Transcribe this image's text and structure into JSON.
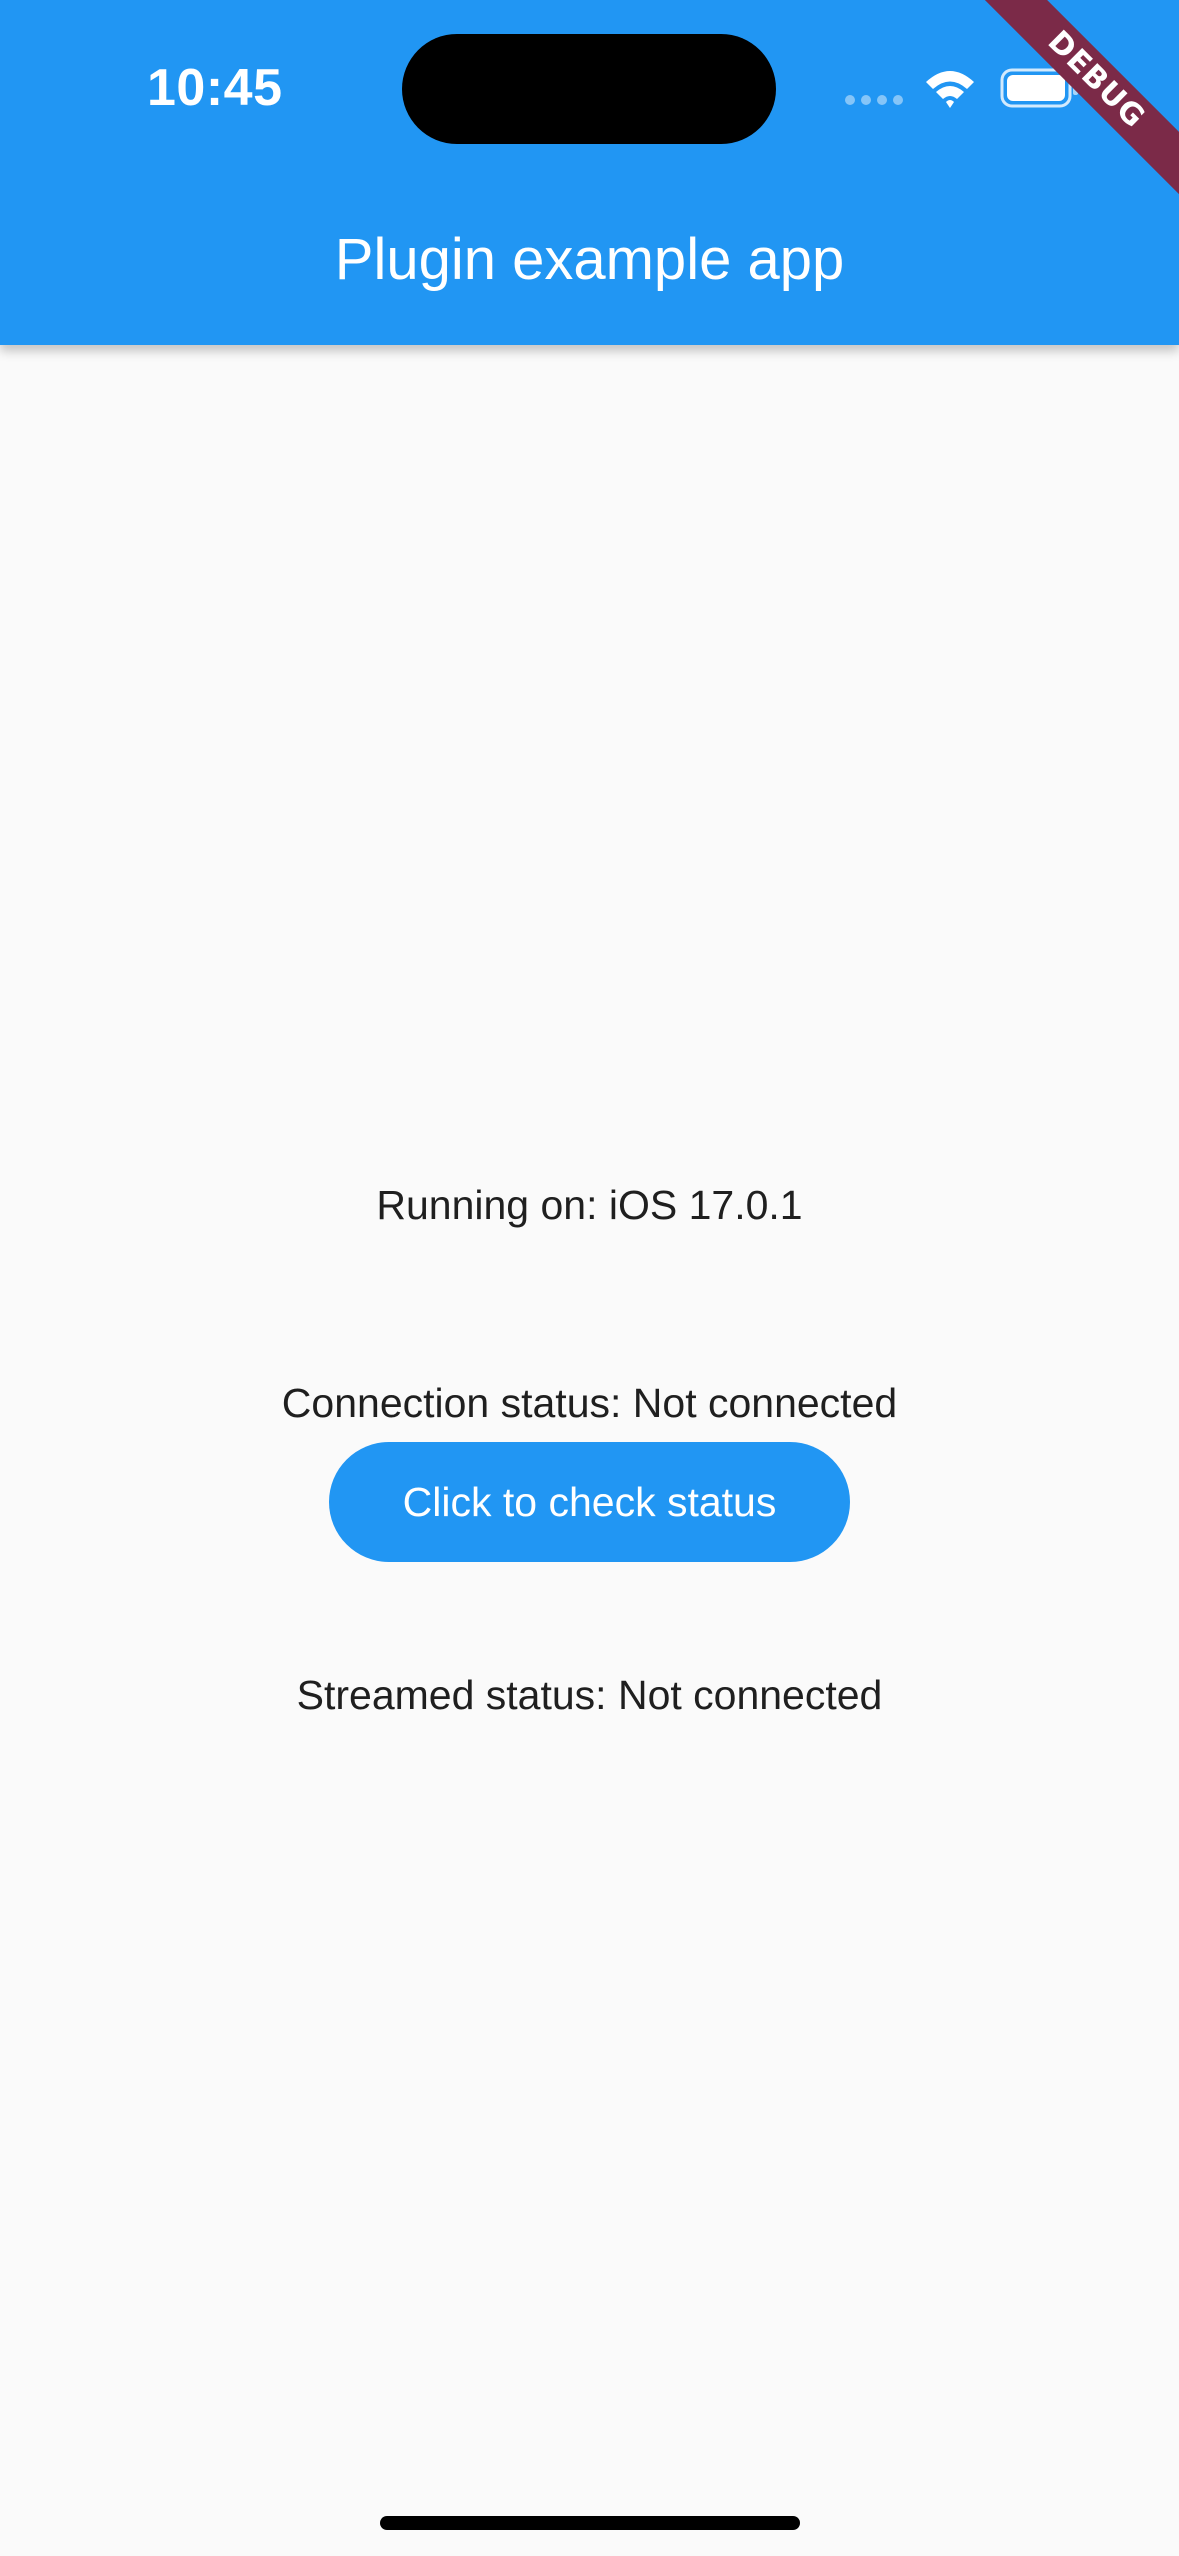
{
  "status_bar": {
    "time": "10:45",
    "icons": [
      "cellular-signal-icon",
      "wifi-icon",
      "battery-icon"
    ]
  },
  "debug_banner": {
    "label": "DEBUG"
  },
  "app_bar": {
    "title": "Plugin example app",
    "color": "#2196f3"
  },
  "main": {
    "running_on": "Running on: iOS 17.0.1",
    "connection_status": "Connection status: Not connected",
    "check_button_label": "Click to check status",
    "streamed_status": "Streamed status: Not connected"
  },
  "colors": {
    "accent": "#2196f3",
    "debug_banner": "#7b2a48",
    "background": "#fafafa"
  }
}
